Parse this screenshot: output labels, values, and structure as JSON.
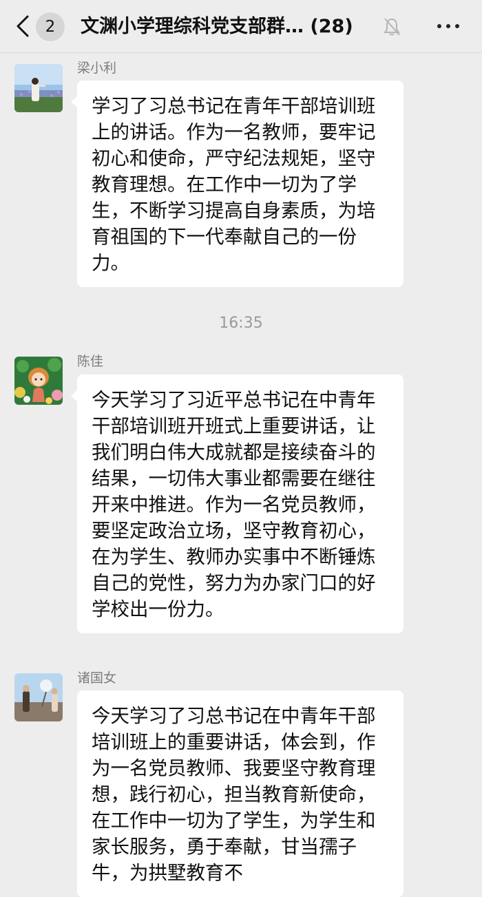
{
  "header": {
    "back_count": "2",
    "title": "文渊小学理综科党支部群…",
    "member_count": "(28)",
    "back_icon": "chevron-left-icon",
    "mute_icon": "bell-muted-icon",
    "more_icon": "more-horizontal-icon"
  },
  "messages": [
    {
      "sender": "梁小利",
      "text": "学习了习总书记在青年干部培训班上的讲话。作为一名教师，要牢记初心和使命，严守纪法规矩，坚守教育理想。在工作中一切为了学生，不断学习提高自身素质，为培育祖国的下一代奉献自己的一份力。"
    },
    {
      "sender": "陈佳",
      "text": "今天学习了习近平总书记在中青年干部培训班开班式上重要讲话，让我们明白伟大成就都是接续奋斗的结果，一切伟大事业都需要在继往开来中推进。作为一名党员教师，要坚定政治立场，坚守教育初心，在为学生、教师办实事中不断锤炼自己的党性，努力为办家门口的好学校出一份力。"
    },
    {
      "sender": "诸国女",
      "text": "今天学习了习总书记在中青年干部培训班上的重要讲话，体会到，作为一名党员教师、我要坚守教育理想，践行初心，担当教育新使命，在工作中一切为了学生，为学生和家长服务，勇于奉献，甘当孺子牛，为拱墅教育不"
    }
  ],
  "timestamp": "16:35"
}
